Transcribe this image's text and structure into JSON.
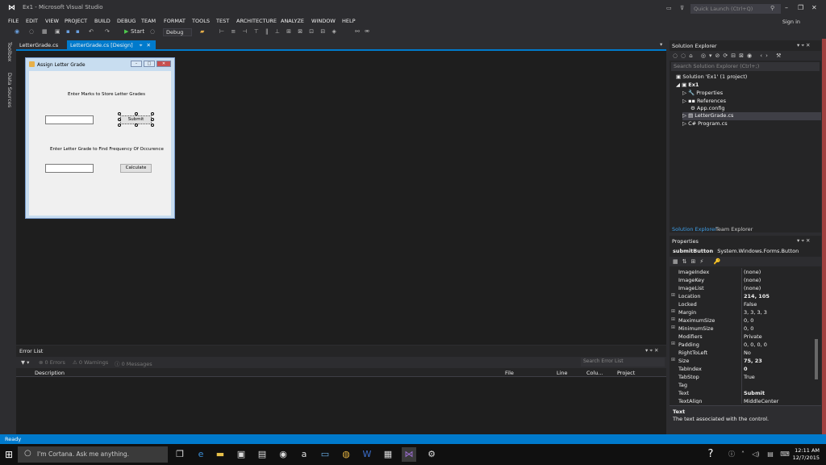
{
  "window": {
    "title": "Ex1 - Microsoft Visual Studio",
    "quick_launch": "Quick Launch (Ctrl+Q)",
    "sign_in": "Sign in"
  },
  "menu": [
    "FILE",
    "EDIT",
    "VIEW",
    "PROJECT",
    "BUILD",
    "DEBUG",
    "TEAM",
    "FORMAT",
    "TOOLS",
    "TEST",
    "ARCHITECTURE",
    "ANALYZE",
    "WINDOW",
    "HELP"
  ],
  "toolbar": {
    "start_label": "Start",
    "config": "Debug"
  },
  "left_strip": [
    "Toolbox",
    "Data Sources"
  ],
  "tabs": [
    {
      "label": "LetterGrade.cs"
    },
    {
      "label": "LetterGrade.cs [Design]"
    }
  ],
  "form": {
    "title": "Assign Letter Grade",
    "label1": "Enter Marks to Store Letter Grades",
    "submit": "Submit",
    "label2": "Enter Letter Grade to Find Frequency Of Occurence",
    "calculate": "Calculate"
  },
  "error_list": {
    "title": "Error List",
    "errors": "0 Errors",
    "warnings": "0 Warnings",
    "messages": "0 Messages",
    "search": "Search Error List",
    "columns": [
      "Description",
      "File",
      "Line",
      "Colu...",
      "Project"
    ]
  },
  "solution_explorer": {
    "title": "Solution Explorer",
    "search": "Search Solution Explorer (Ctrl+;)",
    "items": [
      "Solution 'Ex1' (1 project)",
      "Ex1",
      "Properties",
      "References",
      "App.config",
      "LetterGrade.cs",
      "Program.cs"
    ],
    "tab_active": "Solution Explorer",
    "tab_other": "Team Explorer"
  },
  "properties": {
    "title": "Properties",
    "object_name": "submitButton",
    "object_type": "System.Windows.Forms.Button",
    "rows": [
      {
        "name": "ImageIndex",
        "value": "(none)",
        "expand": ""
      },
      {
        "name": "ImageKey",
        "value": "(none)",
        "expand": ""
      },
      {
        "name": "ImageList",
        "value": "(none)",
        "expand": ""
      },
      {
        "name": "Location",
        "value": "214, 105",
        "expand": "⊞"
      },
      {
        "name": "Locked",
        "value": "False",
        "expand": ""
      },
      {
        "name": "Margin",
        "value": "3, 3, 3, 3",
        "expand": "⊞"
      },
      {
        "name": "MaximumSize",
        "value": "0, 0",
        "expand": "⊞"
      },
      {
        "name": "MinimumSize",
        "value": "0, 0",
        "expand": "⊞"
      },
      {
        "name": "Modifiers",
        "value": "Private",
        "expand": ""
      },
      {
        "name": "Padding",
        "value": "0, 0, 0, 0",
        "expand": "⊞"
      },
      {
        "name": "RightToLeft",
        "value": "No",
        "expand": ""
      },
      {
        "name": "Size",
        "value": "75, 23",
        "expand": "⊞"
      },
      {
        "name": "TabIndex",
        "value": "0",
        "expand": ""
      },
      {
        "name": "TabStop",
        "value": "True",
        "expand": ""
      },
      {
        "name": "Tag",
        "value": "",
        "expand": ""
      },
      {
        "name": "Text",
        "value": "Submit",
        "expand": ""
      },
      {
        "name": "TextAlign",
        "value": "MiddleCenter",
        "expand": ""
      }
    ],
    "desc_title": "Text",
    "desc_text": "The text associated with the control."
  },
  "status": "Ready",
  "taskbar": {
    "cortana": "I'm Cortana. Ask me anything.",
    "time": "12:11 AM",
    "date": "12/7/2015"
  }
}
